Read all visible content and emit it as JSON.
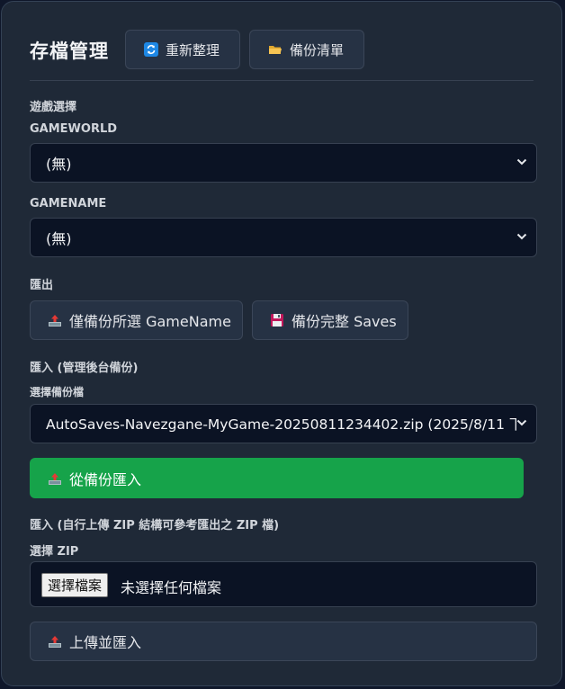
{
  "header": {
    "title": "存檔管理",
    "refresh_label": "重新整理",
    "backup_list_label": "備份清單"
  },
  "game_select": {
    "section_label": "遊戲選擇",
    "gameworld_label": "GAMEWORLD",
    "gameworld_value": "(無)",
    "gamename_label": "GAMENAME",
    "gamename_value": "(無)"
  },
  "export": {
    "section_label": "匯出",
    "backup_selected_label": "僅備份所選 GameName",
    "backup_full_label": "備份完整 Saves"
  },
  "import_backend": {
    "section_label": "匯入 (管理後台備份)",
    "file_label": "選擇備份檔",
    "file_value": "AutoSaves-Navezgane-MyGame-20250811234402.zip (2025/8/11 下",
    "import_button": "從備份匯入"
  },
  "import_upload": {
    "section_label": "匯入 (自行上傳 ZIP 結構可參考匯出之 ZIP 檔)",
    "zip_label": "選擇 ZIP",
    "choose_file_button": "選擇檔案",
    "no_file_text": "未選擇任何檔案",
    "upload_button": "上傳並匯入"
  },
  "colors": {
    "background": "#1f2937",
    "success": "#16a34a"
  },
  "icons": [
    "refresh-icon",
    "folder-icon",
    "upload-icon",
    "floppy-disk-icon"
  ]
}
